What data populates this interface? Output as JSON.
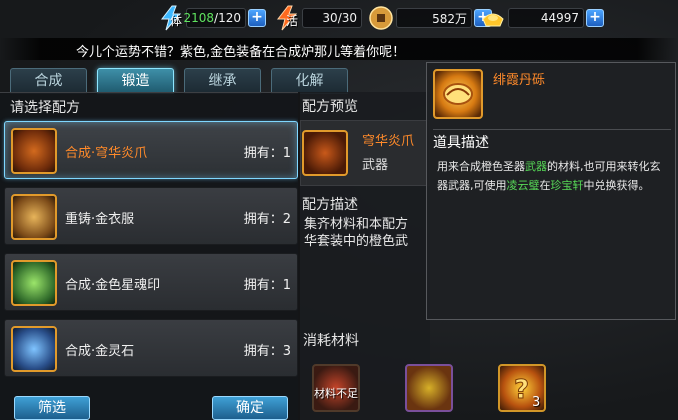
{
  "resources": {
    "stamina": {
      "icon": "lightning-stamina-icon",
      "label": "体",
      "current": "2108",
      "max": "/120"
    },
    "vitality": {
      "icon": "lightning-vitality-icon",
      "label": "活",
      "current": "30",
      "max": "/30"
    },
    "coins": {
      "icon": "copper-coin-icon",
      "value": "582万"
    },
    "gold": {
      "icon": "gold-ingot-icon",
      "value": "44997"
    },
    "plus_label": "+"
  },
  "marquee": "今儿个运势不错？紫色,金色装备在合成炉那儿等着你呢！",
  "tabs": [
    {
      "label": "合成",
      "active": false
    },
    {
      "label": "锻造",
      "active": true
    },
    {
      "label": "继承",
      "active": false
    },
    {
      "label": "化解",
      "active": false
    }
  ],
  "recipe_panel": {
    "title": "请选择配方",
    "items": [
      {
        "name": "合成·穹华炎爪",
        "own": "拥有：1",
        "selected": true,
        "icon": "recipe-scroll-icon"
      },
      {
        "name": "重铸·金衣服",
        "own": "拥有：2",
        "selected": false,
        "icon": "recipe-scroll-icon"
      },
      {
        "name": "合成·金色星魂印",
        "own": "拥有：1",
        "selected": false,
        "icon": "recipe-scroll-icon"
      },
      {
        "name": "合成·金灵石",
        "own": "拥有：3",
        "selected": false,
        "icon": "recipe-scroll-icon"
      }
    ],
    "filter_button": "筛选",
    "confirm_button": "确定"
  },
  "preview": {
    "title": "配方预览",
    "item_name": "穹华炎爪",
    "item_type": "武器",
    "desc_title": "配方描述",
    "desc_line1": "集齐材料和本配方",
    "desc_line2": "华套装中的橙色武"
  },
  "tooltip": {
    "name": "绯霞丹砾",
    "heading": "道具描述",
    "body_part1": "用来合成橙色圣器",
    "body_highlight1": "武器",
    "body_part2": "的材料,也可用来转化玄器武器,可使用",
    "body_highlight2": "凌云璧",
    "body_part3": "在",
    "body_highlight3": "珍宝轩",
    "body_part4": "中兑换获得。",
    "icon": "cinnabar-gem-icon"
  },
  "consume": {
    "title": "消耗材料",
    "insufficient_label": "材料不足",
    "third_count": "3",
    "items": [
      "red-orb-material-icon",
      "golden-claw-material-icon",
      "mystery-gem-icon"
    ]
  }
}
